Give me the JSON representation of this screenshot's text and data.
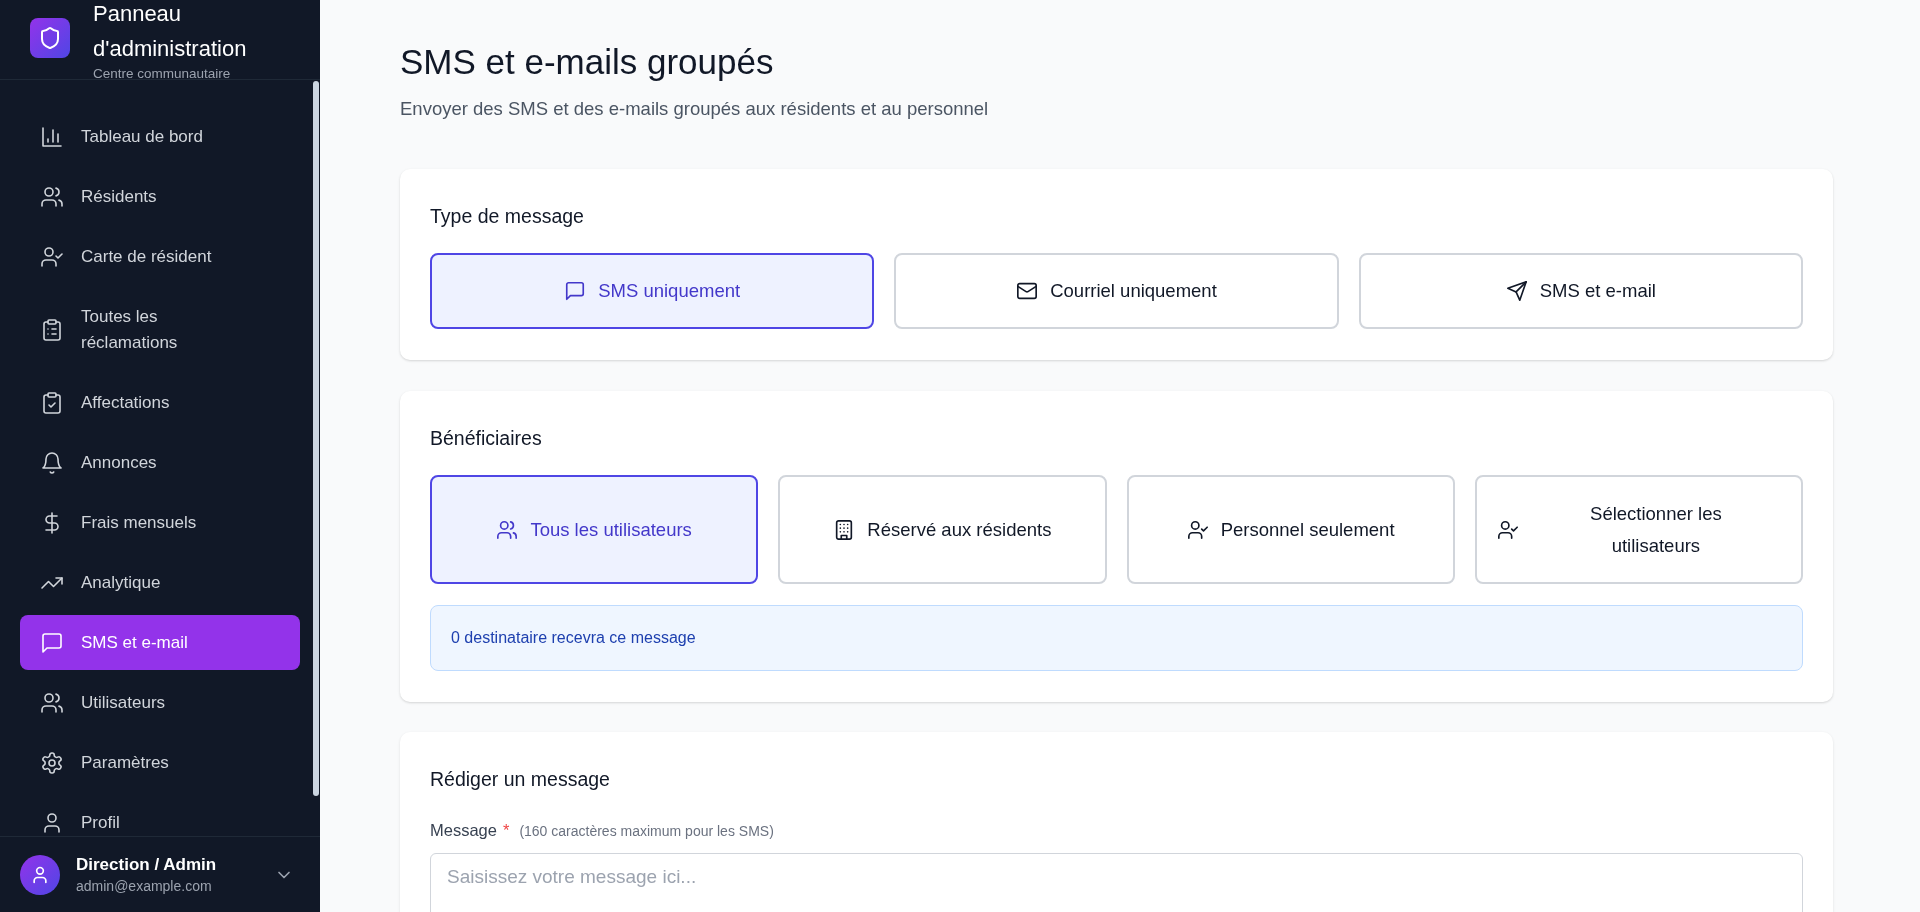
{
  "sidebar": {
    "title": "Panneau d'administration",
    "subtitle": "Centre communautaire",
    "items": [
      {
        "label": "Tableau de bord",
        "selected": false
      },
      {
        "label": "Résidents",
        "selected": false
      },
      {
        "label": "Carte de résident",
        "selected": false
      },
      {
        "label": "Toutes les réclamations",
        "selected": false
      },
      {
        "label": "Affectations",
        "selected": false
      },
      {
        "label": "Annonces",
        "selected": false
      },
      {
        "label": "Frais mensuels",
        "selected": false
      },
      {
        "label": "Analytique",
        "selected": false
      },
      {
        "label": "SMS et e-mail",
        "selected": true
      },
      {
        "label": "Utilisateurs",
        "selected": false
      },
      {
        "label": "Paramètres",
        "selected": false
      },
      {
        "label": "Profil",
        "selected": false
      }
    ],
    "user": {
      "name": "Direction / Admin",
      "email": "admin@example.com"
    }
  },
  "page": {
    "title": "SMS et e-mails groupés",
    "subtitle": "Envoyer des SMS et des e-mails groupés aux résidents et au personnel"
  },
  "message_type": {
    "heading": "Type de message",
    "options": [
      {
        "label": "SMS uniquement",
        "selected": true
      },
      {
        "label": "Courriel uniquement",
        "selected": false
      },
      {
        "label": "SMS et e-mail",
        "selected": false
      }
    ]
  },
  "recipients": {
    "heading": "Bénéficiaires",
    "options": [
      {
        "label": "Tous les utilisateurs",
        "selected": true
      },
      {
        "label": "Réservé aux résidents",
        "selected": false
      },
      {
        "label": "Personnel seulement",
        "selected": false
      },
      {
        "label": "Sélectionner les utilisateurs",
        "selected": false
      }
    ],
    "notice": "0 destinataire recevra ce message"
  },
  "compose": {
    "heading": "Rédiger un message",
    "label": "Message",
    "required_mark": "*",
    "hint": "(160 caractères maximum pour les SMS)",
    "placeholder": "Saisissez votre message ici..."
  }
}
